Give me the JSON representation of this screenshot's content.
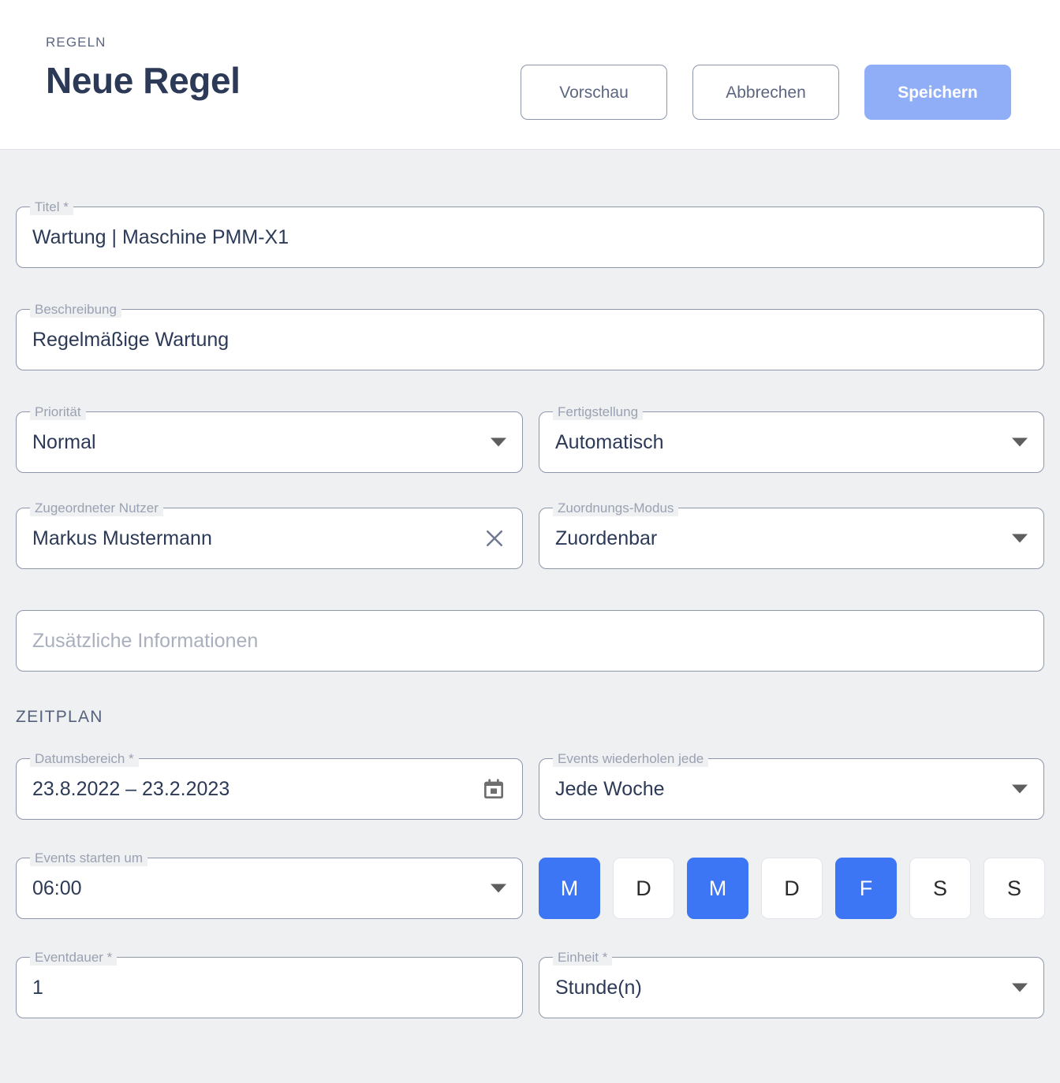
{
  "header": {
    "breadcrumb": "REGELN",
    "title": "Neue Regel",
    "buttons": {
      "preview": "Vorschau",
      "cancel": "Abbrechen",
      "save": "Speichern"
    },
    "colors": {
      "save_bg": "#90aef8",
      "title": "#2c3a57"
    }
  },
  "form": {
    "title_field": {
      "label": "Titel *",
      "value": "Wartung | Maschine PMM-X1"
    },
    "description_field": {
      "label": "Beschreibung",
      "value": "Regelmäßige Wartung"
    },
    "priority_field": {
      "label": "Priorität",
      "value": "Normal"
    },
    "completion_field": {
      "label": "Fertigstellung",
      "value": "Automatisch"
    },
    "assigned_user_field": {
      "label": "Zugeordneter Nutzer",
      "value": "Markus Mustermann"
    },
    "assignment_mode_field": {
      "label": "Zuordnungs-Modus",
      "value": "Zuordenbar"
    },
    "additional_info_field": {
      "label": "",
      "placeholder": "Zusätzliche Informationen",
      "value": ""
    }
  },
  "schedule": {
    "section_title": "ZEITPLAN",
    "date_range_field": {
      "label": "Datumsbereich *",
      "value": "23.8.2022 – 23.2.2023"
    },
    "repeat_field": {
      "label": "Events wiederholen jede",
      "value": "Jede Woche"
    },
    "start_time_field": {
      "label": "Events starten um",
      "value": "06:00"
    },
    "duration_field": {
      "label": "Eventdauer *",
      "value": "1"
    },
    "unit_field": {
      "label": "Einheit *",
      "value": "Stunde(n)"
    },
    "weekdays": [
      {
        "label": "M",
        "selected": true
      },
      {
        "label": "D",
        "selected": false
      },
      {
        "label": "M",
        "selected": true
      },
      {
        "label": "D",
        "selected": false
      },
      {
        "label": "F",
        "selected": true
      },
      {
        "label": "S",
        "selected": false
      },
      {
        "label": "S",
        "selected": false
      }
    ],
    "selected_color": "#3d76f5"
  }
}
